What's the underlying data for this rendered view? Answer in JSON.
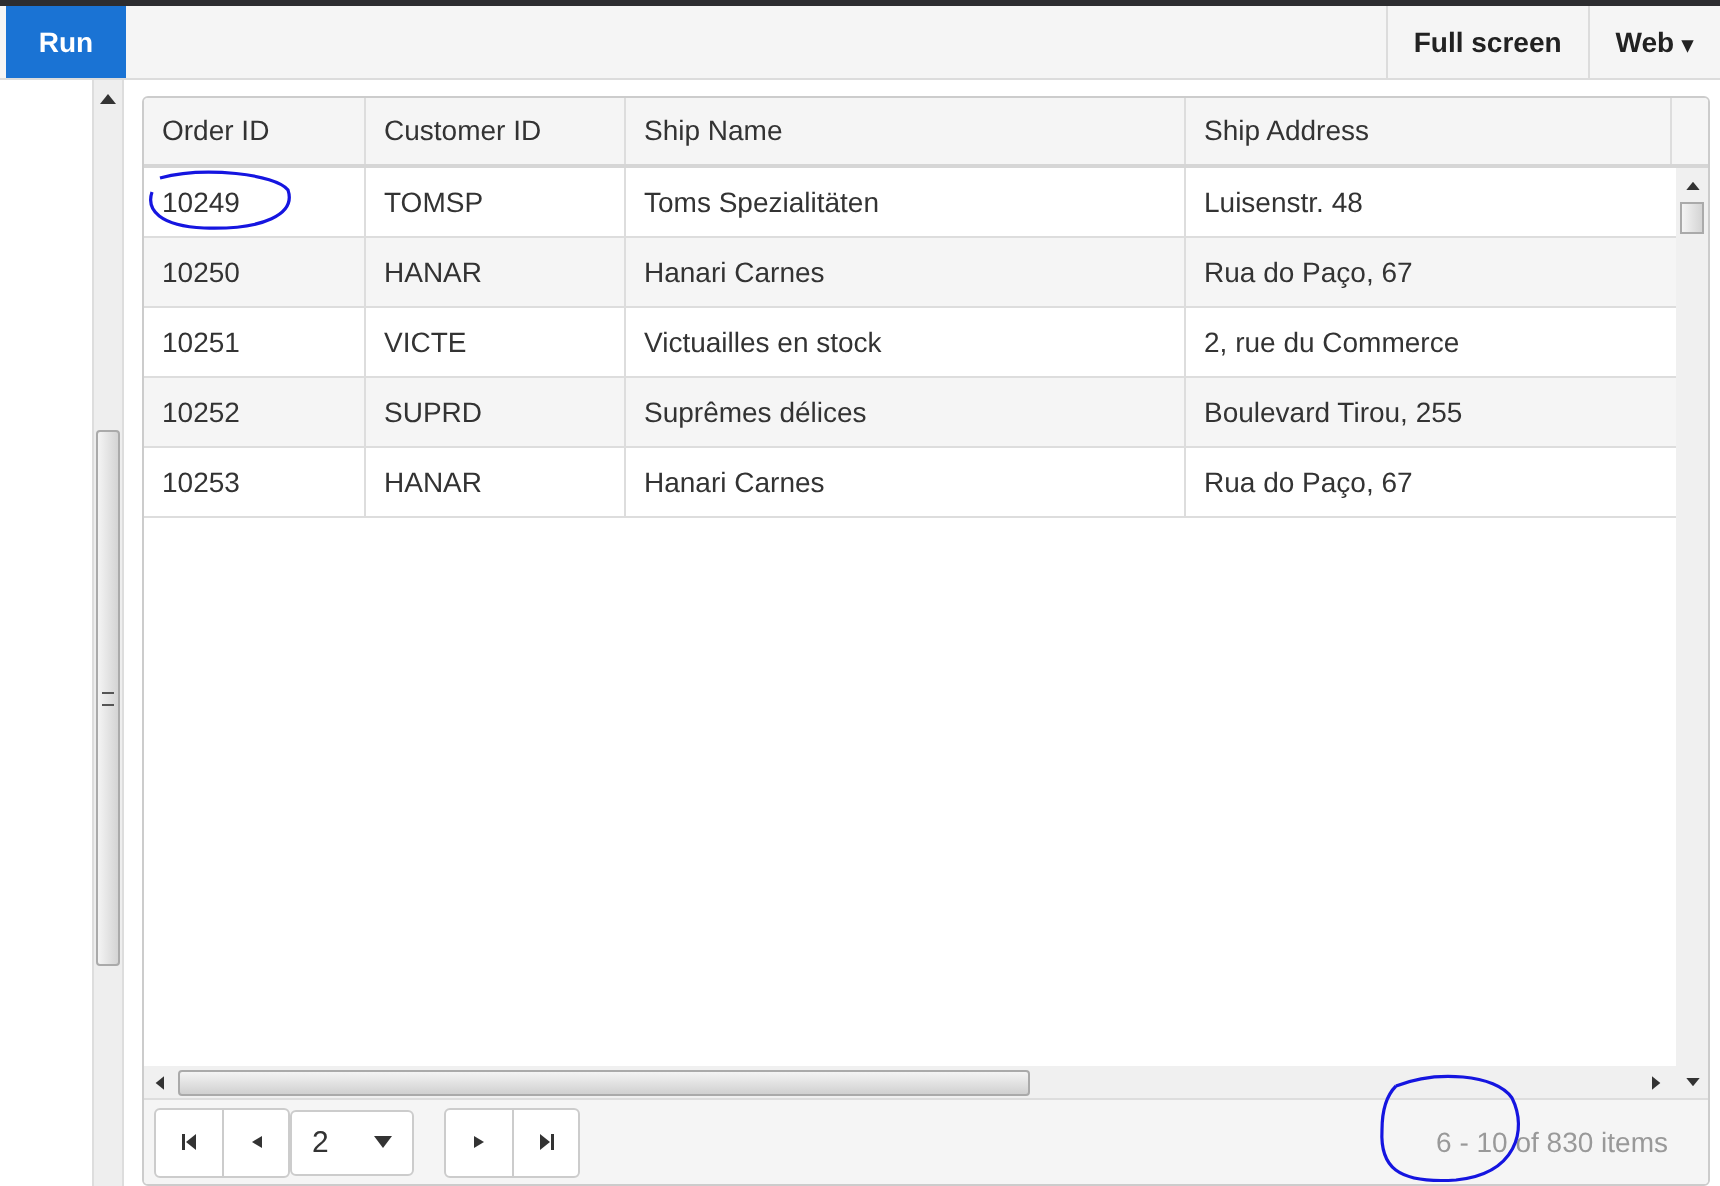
{
  "toolbar": {
    "run": "Run",
    "full_screen": "Full screen",
    "platform": "Web",
    "platform_caret": "▾"
  },
  "grid": {
    "columns": [
      "Order ID",
      "Customer ID",
      "Ship Name",
      "Ship Address"
    ],
    "rows": [
      {
        "cells": [
          "10249",
          "TOMSP",
          "Toms Spezialitäten",
          "Luisenstr. 48"
        ]
      },
      {
        "cells": [
          "10250",
          "HANAR",
          "Hanari Carnes",
          "Rua do Paço, 67"
        ]
      },
      {
        "cells": [
          "10251",
          "VICTE",
          "Victuailles en stock",
          "2, rue du Commerce"
        ]
      },
      {
        "cells": [
          "10252",
          "SUPRD",
          "Suprêmes délices",
          "Boulevard Tirou, 255"
        ]
      },
      {
        "cells": [
          "10253",
          "HANAR",
          "Hanari Carnes",
          "Rua do Paço, 67"
        ]
      }
    ]
  },
  "pager": {
    "page": "2",
    "info": "6 - 10 of 830 items"
  }
}
